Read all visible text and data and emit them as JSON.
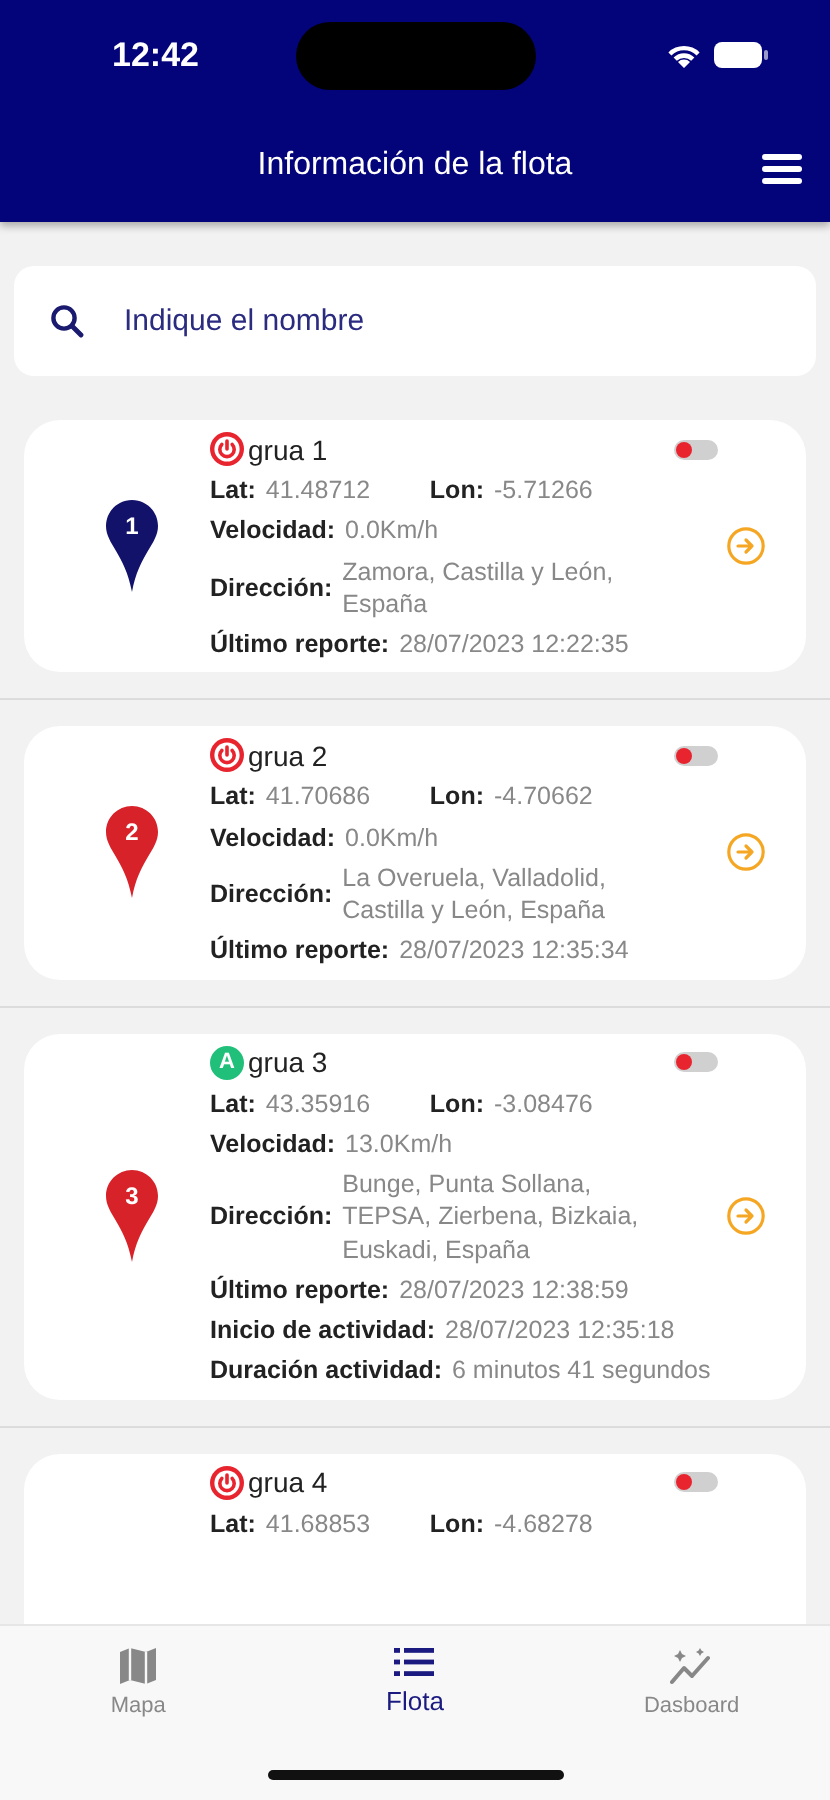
{
  "status_bar": {
    "time": "12:42"
  },
  "header": {
    "title": "Información de la flota"
  },
  "search": {
    "placeholder": "Indique el nombre"
  },
  "vehicles": [
    {
      "name": "grua 1",
      "status": {
        "kind": "off"
      },
      "toggle_on": false,
      "pin": {
        "number": "1",
        "color": "#12126a"
      },
      "lat_label": "Lat:",
      "lat": "41.48712",
      "lon_label": "Lon:",
      "lon": "-5.71266",
      "fields": [
        {
          "label": "Velocidad:",
          "value": "0.0Km/h"
        },
        {
          "label": "Dirección:",
          "value": "Zamora, Castilla y León, España"
        },
        {
          "label": "Último reporte:",
          "value": "28/07/2023 12:22:35"
        }
      ],
      "go_button": true
    },
    {
      "name": "grua 2",
      "status": {
        "kind": "off"
      },
      "toggle_on": false,
      "pin": {
        "number": "2",
        "color": "#d8222a"
      },
      "lat_label": "Lat:",
      "lat": "41.70686",
      "lon_label": "Lon:",
      "lon": "-4.70662",
      "fields": [
        {
          "label": "Velocidad:",
          "value": "0.0Km/h"
        },
        {
          "label": "Dirección:",
          "value": "La Overuela, Valladolid, Castilla y León, España"
        },
        {
          "label": "Último reporte:",
          "value": "28/07/2023 12:35:34"
        }
      ],
      "go_button": true
    },
    {
      "name": "grua 3",
      "status": {
        "kind": "letter",
        "letter": "A"
      },
      "toggle_on": false,
      "pin": {
        "number": "3",
        "color": "#d8222a"
      },
      "lat_label": "Lat:",
      "lat": "43.35916",
      "lon_label": "Lon:",
      "lon": "-3.08476",
      "fields": [
        {
          "label": "Velocidad:",
          "value": "13.0Km/h"
        },
        {
          "label": "Dirección:",
          "value": "Bunge, Punta Sollana, TEPSA, Zierbena, Bizkaia, Euskadi, España"
        },
        {
          "label": "Último reporte:",
          "value": "28/07/2023 12:38:59"
        },
        {
          "label": "Inicio de actividad:",
          "value": "28/07/2023 12:35:18"
        },
        {
          "label": "Duración actividad:",
          "value": "6 minutos 41 segundos"
        }
      ],
      "go_button": true
    },
    {
      "name": "grua 4",
      "status": {
        "kind": "off"
      },
      "toggle_on": false,
      "lat_label": "Lat:",
      "lat": "41.68853",
      "lon_label": "Lon:",
      "lon": "-4.68278"
    }
  ],
  "tabs": [
    {
      "label": "Mapa",
      "kind": "map",
      "selected": false
    },
    {
      "label": "Flota",
      "kind": "list",
      "selected": true
    },
    {
      "label": "Dasboard",
      "kind": "chart",
      "selected": false
    }
  ]
}
